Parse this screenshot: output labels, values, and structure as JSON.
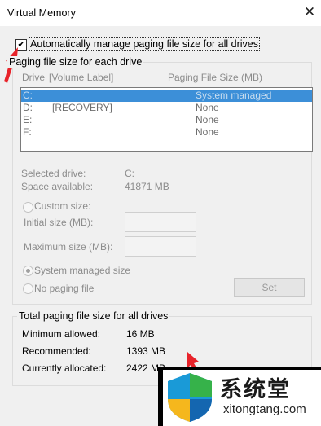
{
  "window": {
    "title": "Virtual Memory",
    "close_glyph": "✕"
  },
  "auto_manage": {
    "label": "Automatically manage paging file size for all drives",
    "checked": true,
    "check_glyph": "✔"
  },
  "paging_group": {
    "legend": "Paging file size for each drive",
    "col_drive": "Drive",
    "col_volume": "[Volume Label]",
    "col_size": "Paging File Size (MB)",
    "drives": [
      {
        "drive": "C:",
        "label": "",
        "size": "System managed",
        "selected": true
      },
      {
        "drive": "D:",
        "label": "[RECOVERY]",
        "size": "None",
        "selected": false
      },
      {
        "drive": "E:",
        "label": "",
        "size": "None",
        "selected": false
      },
      {
        "drive": "F:",
        "label": "",
        "size": "None",
        "selected": false
      }
    ],
    "selected_drive_label": "Selected drive:",
    "selected_drive_value": "C:",
    "space_available_label": "Space available:",
    "space_available_value": "41871 MB",
    "custom_size_label": "Custom size:",
    "initial_size_label": "Initial size (MB):",
    "maximum_size_label": "Maximum size (MB):",
    "system_managed_label": "System managed size",
    "no_paging_label": "No paging file",
    "set_button": "Set",
    "selected_option": "system_managed"
  },
  "total_group": {
    "legend": "Total paging file size for all drives",
    "minimum_label": "Minimum allowed:",
    "minimum_value": "16 MB",
    "recommended_label": "Recommended:",
    "recommended_value": "1393 MB",
    "allocated_label": "Currently allocated:",
    "allocated_value": "2422 MB"
  },
  "watermark": {
    "chinese": "系统堂",
    "url": "xitongtang.com"
  },
  "colors": {
    "selection": "#3c8fd8",
    "arrow": "#e8232a",
    "disabled_text": "#8c8c8c"
  }
}
